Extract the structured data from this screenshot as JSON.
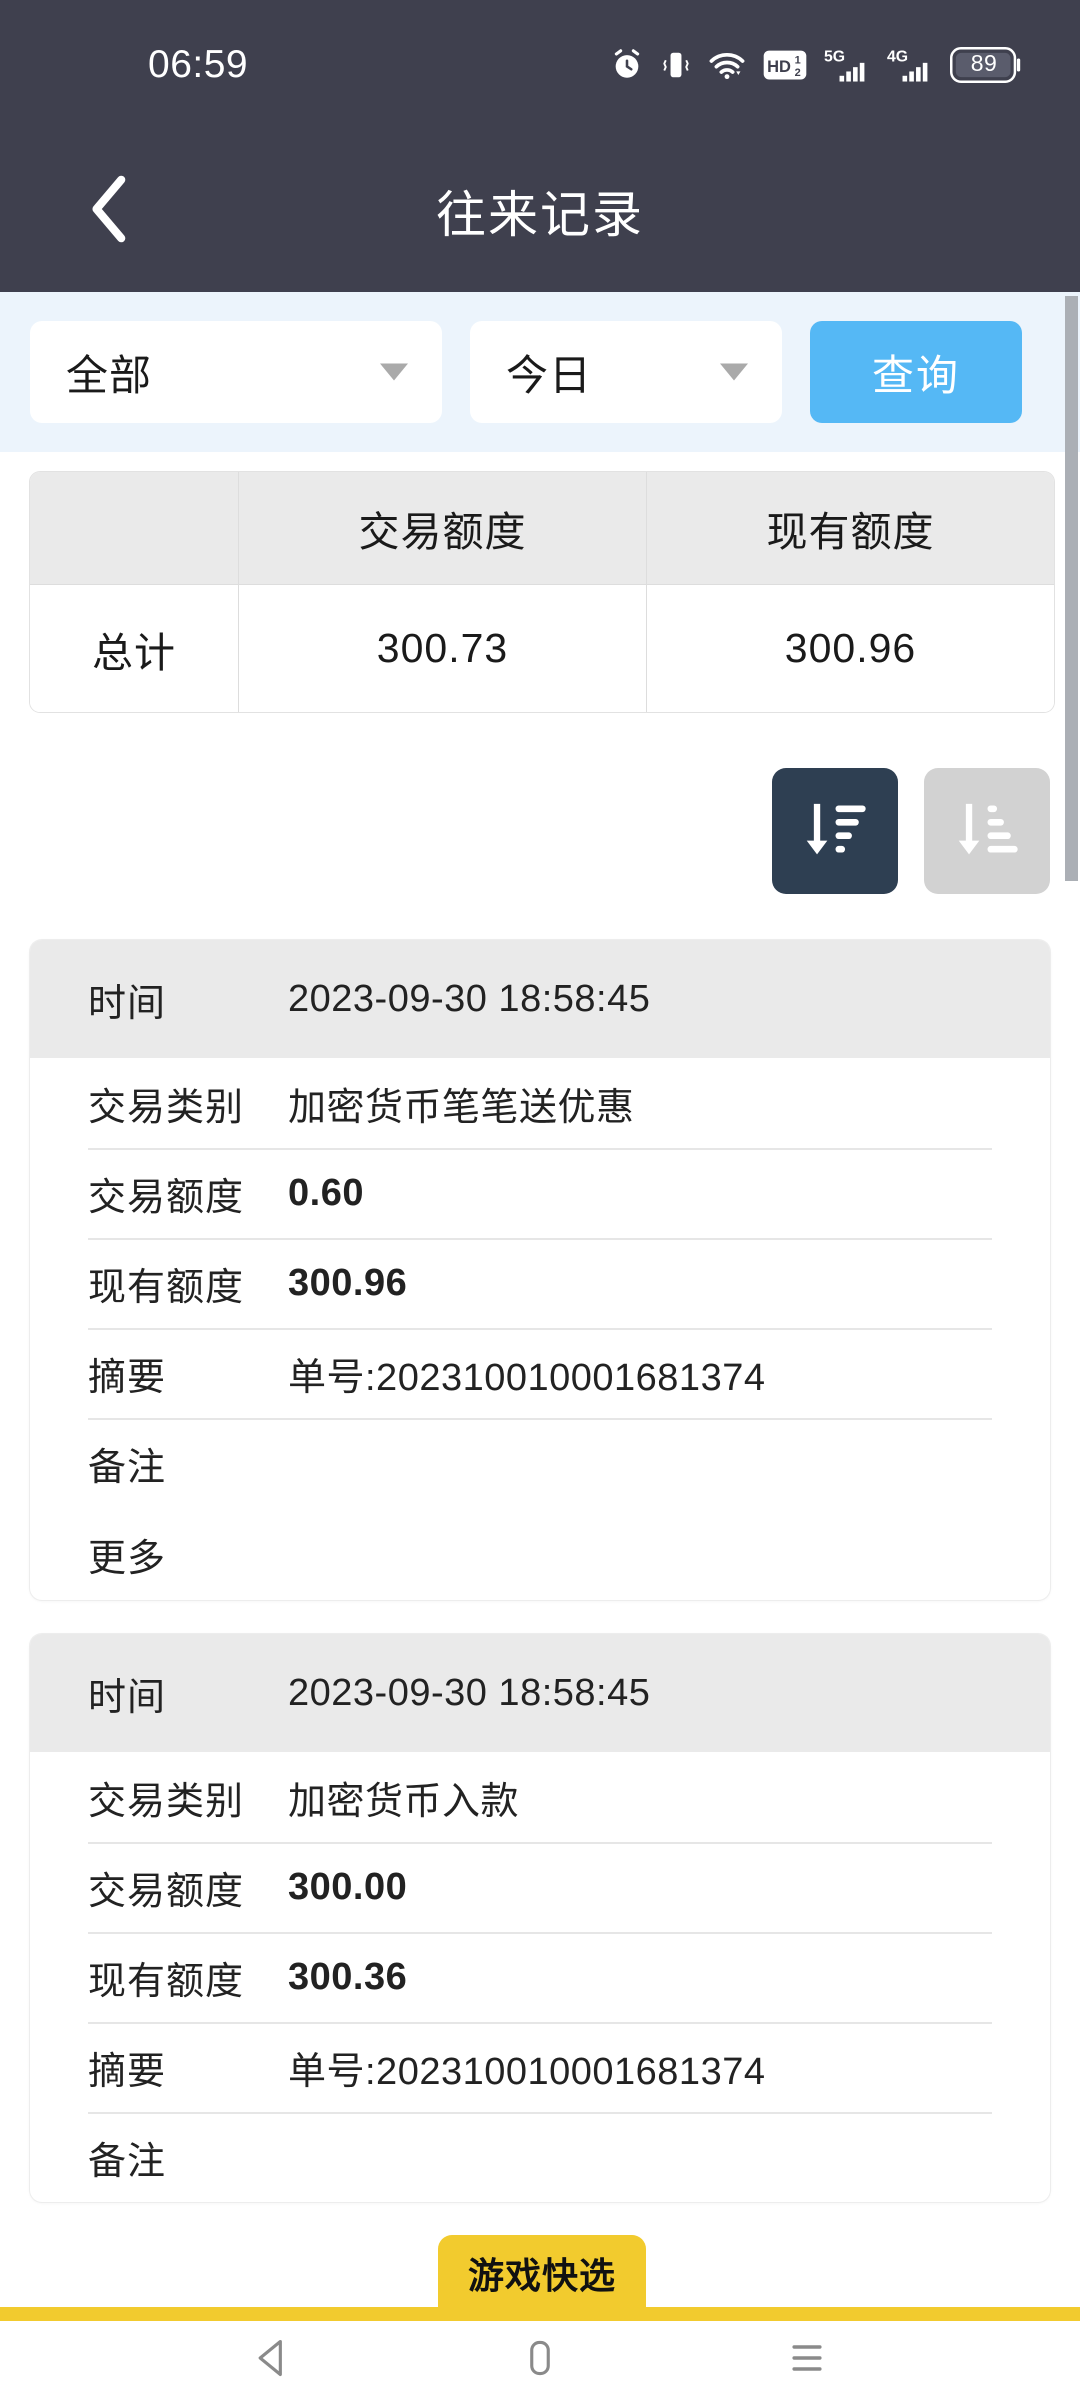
{
  "status_bar": {
    "time": "06:59",
    "battery_level": "89",
    "icons": [
      "alarm-icon",
      "vibrate-icon",
      "wifi-icon",
      "hd-volte-icon",
      "signal-5g-icon",
      "signal-4g-icon",
      "battery-icon"
    ]
  },
  "app_bar": {
    "title": "往来记录",
    "back_icon": "chevron-left-icon"
  },
  "filter_bar": {
    "type_select": {
      "value": "全部",
      "caret_icon": "caret-down-icon"
    },
    "date_select": {
      "value": "今日",
      "caret_icon": "caret-down-icon"
    },
    "query_button": "查询"
  },
  "summary_table": {
    "headers": [
      "",
      "交易额度",
      "现有额度"
    ],
    "rows": [
      {
        "label": "总计",
        "transaction_amount": "300.73",
        "current_balance": "300.96"
      }
    ]
  },
  "sort_controls": {
    "descending_label": "sort-descending",
    "ascending_label": "sort-ascending",
    "active": "descending",
    "active_color": "#2E3F52",
    "inactive_color": "#D2D2D2"
  },
  "records": [
    {
      "time_label": "时间",
      "time_value": "2023-09-30 18:58:45",
      "rows": [
        {
          "label": "交易类别",
          "value": "加密货币笔笔送优惠",
          "bold": false
        },
        {
          "label": "交易额度",
          "value": "0.60",
          "bold": true
        },
        {
          "label": "现有额度",
          "value": "300.96",
          "bold": true
        },
        {
          "label": "摘要",
          "value": "单号:202310010001681374",
          "bold": false
        },
        {
          "label": "备注",
          "value": "",
          "bold": false
        }
      ],
      "more_label": "更多"
    },
    {
      "time_label": "时间",
      "time_value": "2023-09-30 18:58:45",
      "rows": [
        {
          "label": "交易类别",
          "value": "加密货币入款",
          "bold": false
        },
        {
          "label": "交易额度",
          "value": "300.00",
          "bold": true
        },
        {
          "label": "现有额度",
          "value": "300.36",
          "bold": true
        },
        {
          "label": "摘要",
          "value": "单号:202310010001681374",
          "bold": false
        },
        {
          "label": "备注",
          "value": "",
          "bold": false
        }
      ],
      "more_label": ""
    }
  ],
  "game_tab": {
    "label": "游戏快选",
    "color": "#F2CB2E"
  },
  "nav_bar": {
    "back_icon": "triangle-back-icon",
    "home_icon": "home-pill-icon",
    "recents_icon": "menu-lines-icon"
  },
  "colors": {
    "header_bg": "#3F404E",
    "filter_bg": "#ECF4FC",
    "accent_blue": "#55B8F5",
    "card_head_bg": "#EAEAEA",
    "sort_active": "#2E3F52"
  }
}
